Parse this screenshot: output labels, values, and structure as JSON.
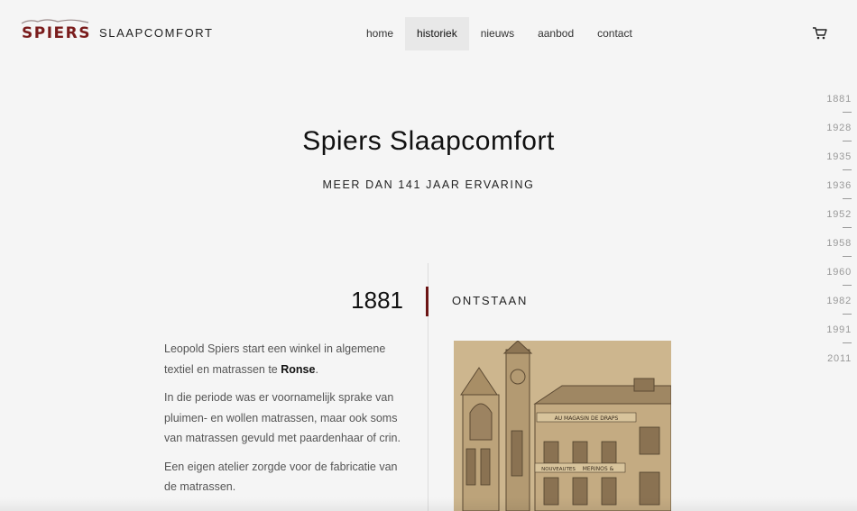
{
  "brand": {
    "logo_word": "SPIERS",
    "logo_sub": "SLAAPCOMFORT",
    "accent_color": "#7a1c1c"
  },
  "nav": {
    "items": [
      {
        "label": "home",
        "active": false
      },
      {
        "label": "historiek",
        "active": true
      },
      {
        "label": "nieuws",
        "active": false
      },
      {
        "label": "aanbod",
        "active": false
      },
      {
        "label": "contact",
        "active": false
      }
    ],
    "cart_icon": "cart-icon"
  },
  "hero": {
    "title": "Spiers Slaapcomfort",
    "subtitle": "MEER DAN 141 JAAR ERVARING"
  },
  "timeline": {
    "years": [
      "1881",
      "1928",
      "1935",
      "1936",
      "1952",
      "1958",
      "1960",
      "1982",
      "1991",
      "2011"
    ]
  },
  "section": {
    "year": "1881",
    "title": "ONTSTAAN",
    "paragraphs": [
      {
        "before": "Leopold Spiers start een winkel in algemene textiel en matrassen te ",
        "bold": "Ronse",
        "after": "."
      },
      {
        "before": "In die periode was er voornamelijk sprake van pluimen- en wollen matrassen, maar ook soms van matrassen gevuld met paardenhaar of crin.",
        "bold": "",
        "after": ""
      },
      {
        "before": "Een eigen atelier zorgde voor de fabricatie van de matrassen.",
        "bold": "",
        "after": ""
      }
    ],
    "photo_signs": [
      "AU MAGASIN DE DRAPS",
      "NOUVEAUTES",
      "MERINOS &"
    ]
  }
}
